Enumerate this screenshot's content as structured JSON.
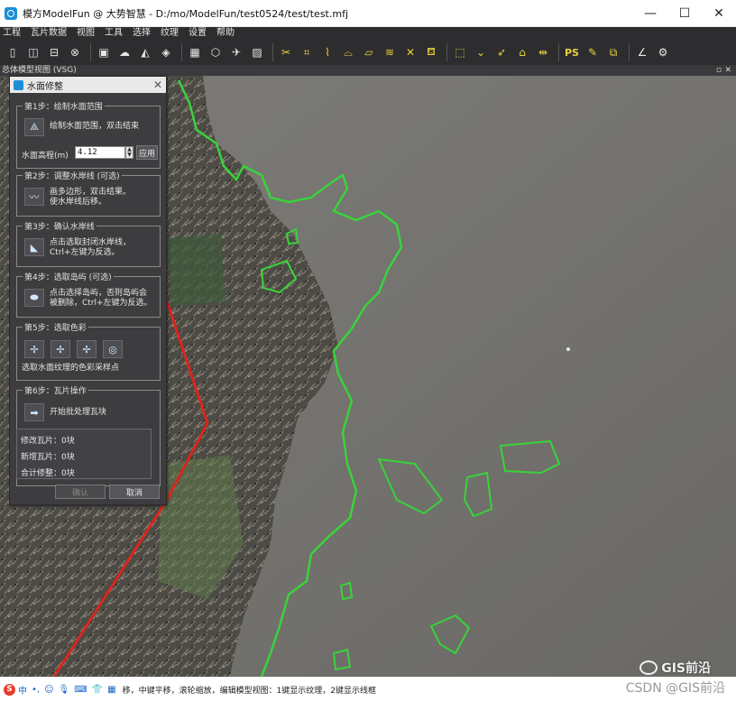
{
  "window": {
    "title": "模方ModelFun @ 大势智慧 - D:/mo/ModelFun/test0524/test/test.mfj",
    "minimize": "—",
    "maximize": "☐",
    "close": "✕"
  },
  "menu": [
    "工程",
    "瓦片数据",
    "视图",
    "工具",
    "选择",
    "纹理",
    "设置",
    "帮助"
  ],
  "toolbar": {
    "ps_label": "PS"
  },
  "view_tab": {
    "label": "总体模型视图 (VSG)",
    "pin": "▫",
    "close": "✕"
  },
  "dialog": {
    "title": "水面修整",
    "close": "✕",
    "step1": {
      "label": "第1步：绘制水面范围",
      "desc": "绘制水面范围，双击结束",
      "elevation_label": "水面高程(m)",
      "elevation_value": "4.12",
      "apply_label": "应用"
    },
    "step2": {
      "label": "第2步：调整水岸线 (可选)",
      "desc_line1": "画多边形，双击结果。",
      "desc_line2": "使水岸线后移。"
    },
    "step3": {
      "label": "第3步：确认水岸线",
      "desc_line1": "点击选取封闭水岸线，",
      "desc_line2": "Ctrl+左键为反选。"
    },
    "step4": {
      "label": "第4步：选取岛屿 (可选)",
      "desc_line1": "点击选择岛屿，否则岛屿会",
      "desc_line2": "被删除，Ctrl+左键为反选。"
    },
    "step5": {
      "label": "第5步：选取色彩",
      "desc": "选取水面纹理的色彩采样点"
    },
    "step6": {
      "label": "第6步：瓦片操作",
      "batch_label": "开始批处理瓦块",
      "stats": {
        "modified": "修改瓦片：0块",
        "added": "新增瓦片：0块",
        "total": "合计修整：0块"
      }
    },
    "confirm_label": "确认",
    "cancel_label": "取消"
  },
  "statusbar": {
    "ime": [
      "中",
      "•,",
      "☺",
      "🎙",
      "⌨",
      "👕",
      "▦"
    ],
    "text": "移，中键平移，滚轮缩放，编辑模型视图：1键显示纹理，2键显示线框"
  },
  "watermark": {
    "line1": "GIS前沿",
    "line2": "CSDN @GIS前沿"
  },
  "colors": {
    "waterline": "#39d33a",
    "red_boundary": "#d8261e",
    "ui_dark": "#2d2d30",
    "accent": "#1c8ed8"
  }
}
